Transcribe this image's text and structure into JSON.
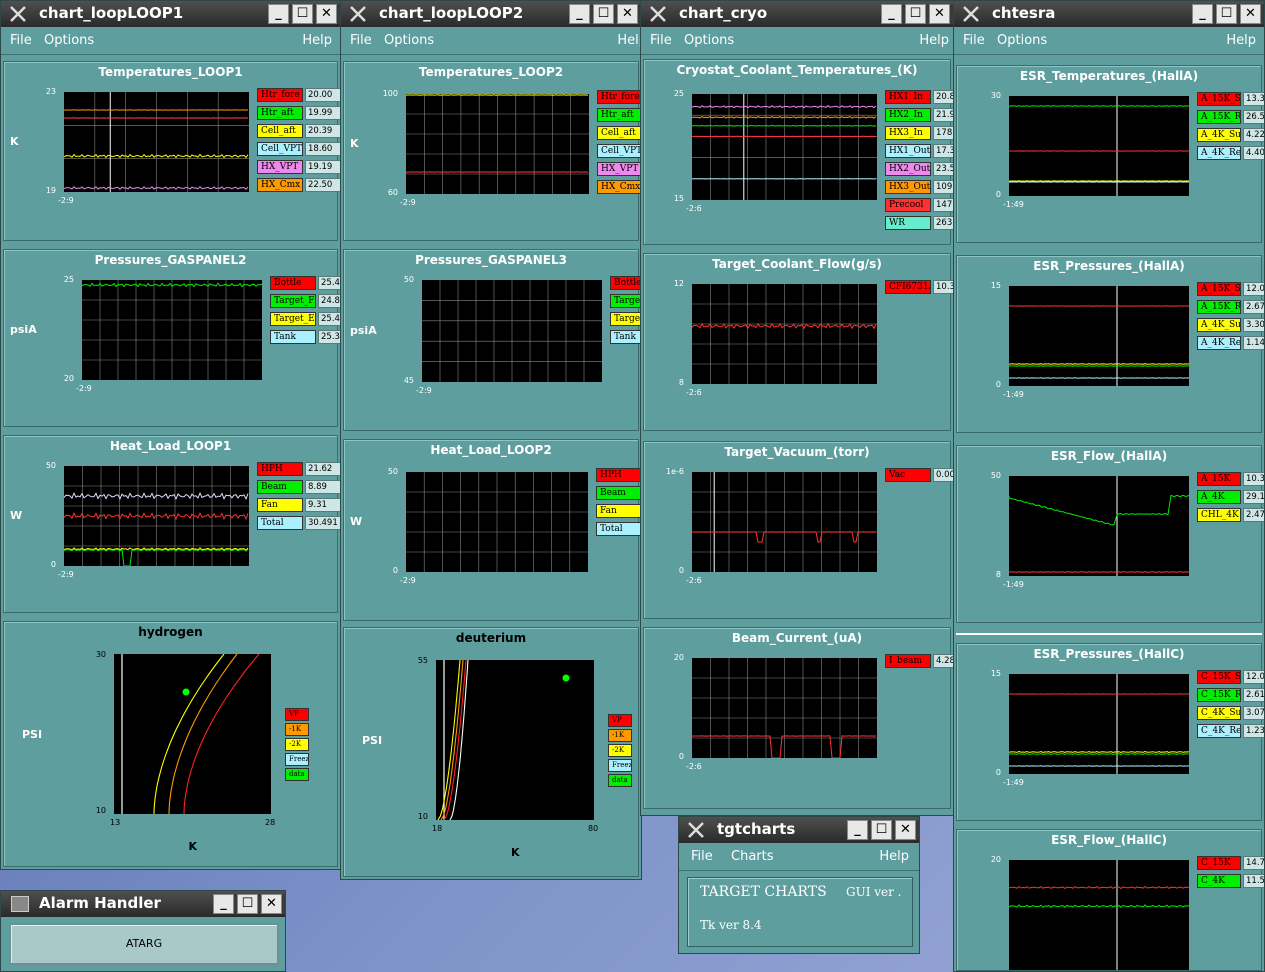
{
  "menus": {
    "file": "File",
    "options": "Options",
    "help": "Help",
    "charts": "Charts"
  },
  "win_loop1": {
    "title": "chart_loopLOOP1",
    "panels": [
      {
        "title": "Temperatures_LOOP1",
        "unit": "K",
        "ymax": "23",
        "ymin": "19",
        "xlabel": "-2:9",
        "legend": [
          {
            "label": "Htr_fore",
            "value": "20.00",
            "color": "#ff0000"
          },
          {
            "label": "Htr_aft",
            "value": "19.99",
            "color": "#00ee00"
          },
          {
            "label": "Cell_aft",
            "value": "20.39",
            "color": "#ffff00"
          },
          {
            "label": "Cell_VPT",
            "value": "18.60",
            "color": "#aaf0ff"
          },
          {
            "label": "HX_VPT",
            "value": "19.19",
            "color": "#ee88ee"
          },
          {
            "label": "HX_Cmx",
            "value": "22.50",
            "color": "#ff9900"
          }
        ]
      },
      {
        "title": "Pressures_GASPANEL2",
        "unit": "psiA",
        "ymax": "25",
        "ymin": "20",
        "xlabel": "-2:9",
        "legend": [
          {
            "label": "Bottle",
            "value": "25.42",
            "color": "#ff0000"
          },
          {
            "label": "Target_Fi",
            "value": "24.82",
            "color": "#00ee00"
          },
          {
            "label": "Target_Ex",
            "value": "25.40",
            "color": "#ffff00"
          },
          {
            "label": "Tank",
            "value": "25.30",
            "color": "#aaf0ff"
          }
        ]
      },
      {
        "title": "Heat_Load_LOOP1",
        "unit": "W",
        "ymax": "50",
        "ymin": "0",
        "xlabel": "-2:9",
        "legend": [
          {
            "label": "HPH",
            "value": "21.62",
            "color": "#ff0000"
          },
          {
            "label": "Beam",
            "value": "8.89",
            "color": "#00ee00"
          },
          {
            "label": "Fan",
            "value": "9.31",
            "color": "#ffff00"
          },
          {
            "label": "Total",
            "value": "30.491",
            "color": "#aaf0ff"
          }
        ]
      },
      {
        "title": "hydrogen",
        "unit": "PSI",
        "ymax": "30",
        "ymin": "10",
        "xmin": "13",
        "xmax": "28",
        "xlabel": "K",
        "legend": [
          {
            "label": "VP",
            "color": "#ff0000"
          },
          {
            "label": "-1K",
            "color": "#ff9900"
          },
          {
            "label": "-2K",
            "color": "#ffff00"
          },
          {
            "label": "Freeze",
            "color": "#aaf0ff"
          },
          {
            "label": "data",
            "color": "#00ee00"
          }
        ]
      }
    ]
  },
  "win_loop2": {
    "title": "chart_loopLOOP2",
    "panels": [
      {
        "title": "Temperatures_LOOP2",
        "unit": "K",
        "ymax": "100",
        "ymin": "60",
        "xlabel": "-2:9",
        "legend": [
          {
            "label": "Htr_fore",
            "color": "#ff0000"
          },
          {
            "label": "Htr_aft",
            "color": "#00ee00"
          },
          {
            "label": "Cell_aft",
            "color": "#ffff00"
          },
          {
            "label": "Cell_VPT",
            "color": "#aaf0ff"
          },
          {
            "label": "HX_VPT",
            "color": "#ee88ee"
          },
          {
            "label": "HX_Cmx",
            "color": "#ff9900"
          }
        ]
      },
      {
        "title": "Pressures_GASPANEL3",
        "unit": "psiA",
        "ymax": "50",
        "ymin": "45",
        "xlabel": "-2:9",
        "legend": [
          {
            "label": "Bottle",
            "color": "#ff0000"
          },
          {
            "label": "Target_",
            "color": "#00ee00"
          },
          {
            "label": "Target_",
            "color": "#ffff00"
          },
          {
            "label": "Tank",
            "color": "#aaf0ff"
          }
        ]
      },
      {
        "title": "Heat_Load_LOOP2",
        "unit": "W",
        "ymax": "50",
        "ymin": "0",
        "xlabel": "-2:9",
        "legend": [
          {
            "label": "HPH",
            "color": "#ff0000"
          },
          {
            "label": "Beam",
            "color": "#00ee00"
          },
          {
            "label": "Fan",
            "color": "#ffff00"
          },
          {
            "label": "Total",
            "color": "#aaf0ff"
          }
        ]
      },
      {
        "title": "deuterium",
        "unit": "PSI",
        "ymax": "55",
        "ymin": "10",
        "xmin": "18",
        "xmax": "80",
        "xlabel": "K",
        "legend": [
          {
            "label": "VP",
            "color": "#ff0000"
          },
          {
            "label": "-1K",
            "color": "#ff9900"
          },
          {
            "label": "-2K",
            "color": "#ffff00"
          },
          {
            "label": "Freeze",
            "color": "#aaf0ff"
          },
          {
            "label": "data",
            "color": "#00ee00"
          }
        ]
      }
    ]
  },
  "win_cryo": {
    "title": "chart_cryo",
    "panels": [
      {
        "title": "Cryostat_Coolant_Temperatures_(K)",
        "ymax": "25",
        "ymin": "15",
        "xlabel": "-2:6",
        "legend": [
          {
            "label": "HX1_In",
            "value": "20.8",
            "color": "#ff0000"
          },
          {
            "label": "HX2_In",
            "value": "21.9",
            "color": "#00ee00"
          },
          {
            "label": "HX3_In",
            "value": "178.0",
            "color": "#ffff00"
          },
          {
            "label": "HX1_Out",
            "value": "17.3",
            "color": "#aaf0ff"
          },
          {
            "label": "HX2_Out",
            "value": "23.5",
            "color": "#ee88ee"
          },
          {
            "label": "HX3_Out",
            "value": "109.7",
            "color": "#ff9900"
          },
          {
            "label": "Precool",
            "value": "147.6",
            "color": "#ff3030"
          },
          {
            "label": "WR",
            "value": "263.8",
            "color": "#66eecc"
          }
        ]
      },
      {
        "title": "Target_Coolant_Flow(g/s)",
        "ymax": "12",
        "ymin": "8",
        "xlabel": "-2:6",
        "legend": [
          {
            "label": "CFI6731A",
            "value": "10.35",
            "color": "#ff0000"
          }
        ]
      },
      {
        "title": "Target_Vacuum_(torr)",
        "ymax": "1e-6",
        "ymin": "0",
        "xlabel": "-2:6",
        "legend": [
          {
            "label": "Vac",
            "value": "0.000",
            "color": "#ff0000"
          }
        ]
      },
      {
        "title": "Beam_Current_(uA)",
        "ymax": "20",
        "ymin": "0",
        "xlabel": "-2:6",
        "legend": [
          {
            "label": "I_beam",
            "value": "4.289",
            "color": "#ff0000"
          }
        ]
      }
    ]
  },
  "win_esr": {
    "title": "chtesra",
    "panels": [
      {
        "title": "ESR_Temperatures_(HallA)",
        "ymax": "30",
        "ymin": "0",
        "xlabel": "-1:49",
        "legend": [
          {
            "label": "A_15K_S",
            "value": "13.31",
            "color": "#ff0000"
          },
          {
            "label": "A_15K_R",
            "value": "26.55",
            "color": "#00ee00"
          },
          {
            "label": "A_4K_Su",
            "value": "4.22",
            "color": "#ffff00"
          },
          {
            "label": "A_4K_Re",
            "value": "4.40",
            "color": "#aaf0ff"
          }
        ]
      },
      {
        "title": "ESR_Pressures_(HallA)",
        "ymax": "15",
        "ymin": "0",
        "xlabel": "-1:49",
        "legend": [
          {
            "label": "A_15K_S",
            "value": "12.05",
            "color": "#ff0000"
          },
          {
            "label": "A_15K_R",
            "value": "2.67",
            "color": "#00ee00"
          },
          {
            "label": "A_4K_Su",
            "value": "3.30",
            "color": "#ffff00"
          },
          {
            "label": "A_4K_Re",
            "value": "1.14",
            "color": "#aaf0ff"
          }
        ]
      },
      {
        "title": "ESR_Flow_(HallA)",
        "ymax": "50",
        "ymin": "8",
        "xlabel": "-1:49",
        "legend": [
          {
            "label": "A_15K",
            "value": "10.35",
            "color": "#ff0000"
          },
          {
            "label": "A_4K",
            "value": "29.15",
            "color": "#00ee00"
          },
          {
            "label": "CHL_4K",
            "value": "2.47",
            "color": "#ffff00"
          }
        ]
      },
      {
        "title": "ESR_Pressures_(HallC)",
        "ymax": "15",
        "ymin": "0",
        "xlabel": "-1:49",
        "legend": [
          {
            "label": "C_15K_S",
            "value": "12.04",
            "color": "#ff0000"
          },
          {
            "label": "C_15K_R",
            "value": "2.61",
            "color": "#00ee00"
          },
          {
            "label": "C_4K_Sup",
            "value": "3.07",
            "color": "#ffff00"
          },
          {
            "label": "C_4K_Re",
            "value": "1.23",
            "color": "#aaf0ff"
          }
        ]
      },
      {
        "title": "ESR_Flow_(HallC)",
        "ymax": "20",
        "ymin": "",
        "xlabel": "",
        "legend": [
          {
            "label": "C_15K",
            "value": "14.77",
            "color": "#ff0000"
          },
          {
            "label": "C_4K",
            "value": "11.57",
            "color": "#00ee00"
          }
        ]
      }
    ]
  },
  "tgt": {
    "title": "tgtcharts",
    "heading": "TARGET CHARTS",
    "gui": "GUI ver .",
    "tk": "Tk ver 8.4"
  },
  "alarm": {
    "title": "Alarm Handler",
    "button": "ATARG"
  }
}
